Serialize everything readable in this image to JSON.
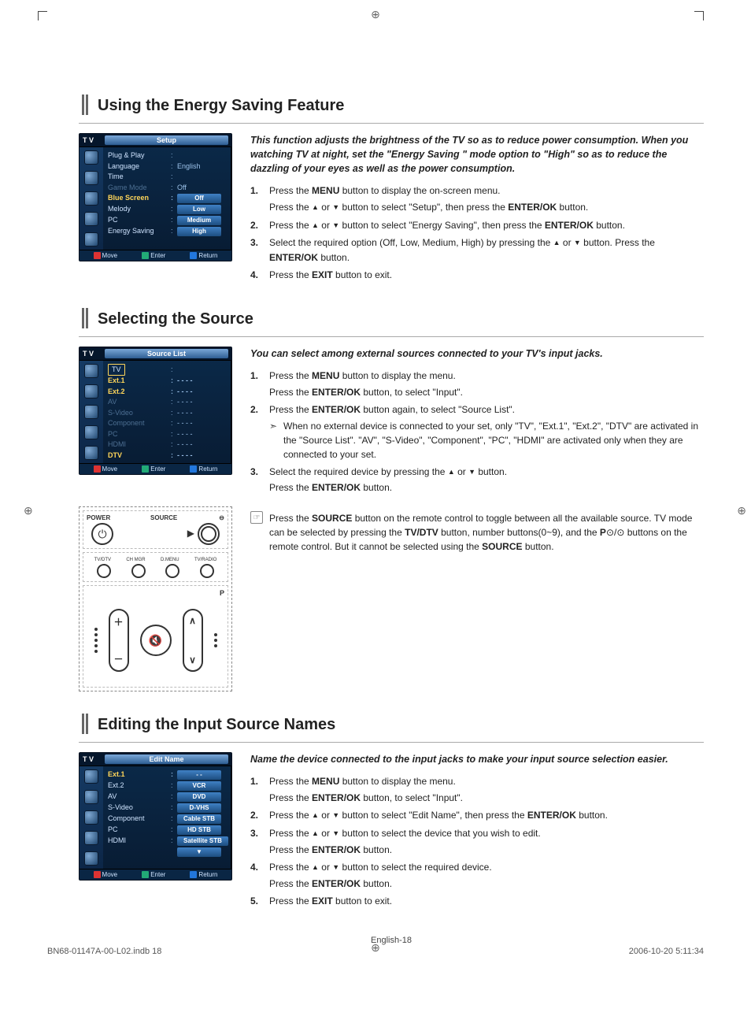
{
  "page": {
    "footer_left": "BN68-01147A-00-L02.indb   18",
    "footer_right": "2006-10-20   5:11:34",
    "page_number": "English-18"
  },
  "section1": {
    "title": "Using the Energy Saving Feature",
    "lead": "This function adjusts the brightness of the TV so as to reduce power consumption. When you watching TV at night, set the  \"Energy Saving \" mode option to \"High\" so as to reduce the dazzling of your eyes as well as the power consumption.",
    "steps": [
      {
        "n": "1.",
        "lines": [
          "Press the <b>MENU</b> button to display the on-screen menu.",
          "Press the <span class='tri'>▲</span> or <span class='tri'>▼</span> button to select \"Setup\", then press the <b>ENTER/OK</b> button."
        ]
      },
      {
        "n": "2.",
        "lines": [
          "Press the <span class='tri'>▲</span> or <span class='tri'>▼</span> button to select \"Energy Saving\", then press the <b>ENTER/OK</b> button."
        ]
      },
      {
        "n": "3.",
        "lines": [
          "Select the required option (Off, Low, Medium, High) by pressing the <span class='tri'>▲</span> or <span class='tri'>▼</span> button. Press the <b>ENTER/OK</b> button."
        ]
      },
      {
        "n": "4.",
        "lines": [
          "Press the <b>EXIT</b> button to exit."
        ]
      }
    ],
    "osd": {
      "header_tv": "T V",
      "header_title": "Setup",
      "rows": [
        {
          "label": "Plug & Play",
          "val": ""
        },
        {
          "label": "Language",
          "val": "English"
        },
        {
          "label": "Time",
          "val": ""
        },
        {
          "label": "Game Mode",
          "val": "Off",
          "dim": true
        },
        {
          "label": "Blue Screen",
          "val": "",
          "pill": "Off",
          "hl": true
        },
        {
          "label": "Melody",
          "val": "",
          "pill": "Low"
        },
        {
          "label": "PC",
          "val": "",
          "pill": "Medium"
        },
        {
          "label": "Energy Saving",
          "val": "",
          "pill": "High"
        }
      ],
      "foot": [
        "Move",
        "Enter",
        "Return"
      ]
    }
  },
  "section2": {
    "title": "Selecting the Source",
    "lead": "You can select among external sources connected to your TV's input jacks.",
    "steps": [
      {
        "n": "1.",
        "lines": [
          "Press the <b>MENU</b> button to display the menu.",
          "Press the <b>ENTER/OK</b> button, to select \"Input\"."
        ]
      },
      {
        "n": "2.",
        "lines": [
          "Press the <b>ENTER/OK</b> button again, to select \"Source List\".",
          "<div class='arrow-note'>When no external device is connected to your set, only \"TV\", \"Ext.1\", \"Ext.2\", \"DTV\"  are activated in the \"Source List\". \"AV\", \"S-Video\", \"Component\", \"PC\", \"HDMI\" are activated only when they are connected to your set.</div>"
        ]
      },
      {
        "n": "3.",
        "lines": [
          "Select the required device by pressing the <span class='tri'>▲</span> or <span class='tri'>▼</span> button.",
          "Press the <b>ENTER/OK</b> button."
        ]
      }
    ],
    "note": "Press the <b>SOURCE</b> button on the remote control to toggle between all the available source. TV mode can be selected by pressing the <b>TV/DTV</b> button, number buttons(0~9), and the <b>P</b>⊙/⊙ buttons on the remote control. But it cannot be selected using the <b>SOURCE</b> button.",
    "osd": {
      "header_tv": "T V",
      "header_title": "Source List",
      "rows": [
        {
          "label": "TV",
          "val": "",
          "sel": true
        },
        {
          "label": "Ext.1",
          "val": "- - - -",
          "hl": true
        },
        {
          "label": "Ext.2",
          "val": "- - - -",
          "hl": true
        },
        {
          "label": "AV",
          "val": "- - - -",
          "dim": true
        },
        {
          "label": "S-Video",
          "val": "- - - -",
          "dim": true
        },
        {
          "label": "Component",
          "val": "- - - -",
          "dim": true
        },
        {
          "label": "PC",
          "val": "- - - -",
          "dim": true
        },
        {
          "label": "HDMI",
          "val": "- - - -",
          "dim": true
        },
        {
          "label": "DTV",
          "val": "- - - -",
          "hl": true
        }
      ],
      "foot": [
        "Move",
        "Enter",
        "Return"
      ]
    },
    "remote": {
      "power": "POWER",
      "source": "SOURCE",
      "row": [
        "TV/DTV",
        "CH MGR",
        "D.MENU",
        "TV/RADIO"
      ]
    }
  },
  "section3": {
    "title": "Editing the Input Source Names",
    "lead": "Name the device connected to the input jacks to make your input source selection easier.",
    "steps": [
      {
        "n": "1.",
        "lines": [
          "Press the <b>MENU</b> button to display the menu.",
          "Press the <b>ENTER/OK</b> button, to select \"Input\"."
        ]
      },
      {
        "n": "2.",
        "lines": [
          "Press the <span class='tri'>▲</span> or <span class='tri'>▼</span> button to select \"Edit Name\", then press the <b>ENTER/OK</b> button."
        ]
      },
      {
        "n": "3.",
        "lines": [
          "Press the <span class='tri'>▲</span> or <span class='tri'>▼</span> button to select the device that you wish to edit.",
          "Press the <b>ENTER/OK</b>  button."
        ]
      },
      {
        "n": "4.",
        "lines": [
          "Press the <span class='tri'>▲</span> or <span class='tri'>▼</span> button to select the required device.",
          "Press the <b>ENTER/OK</b> button."
        ]
      },
      {
        "n": "5.",
        "lines": [
          "Press the <b>EXIT</b> button to exit."
        ]
      }
    ],
    "osd": {
      "header_tv": "T V",
      "header_title": "Edit Name",
      "rows": [
        {
          "label": "Ext.1",
          "val": "",
          "pill": "- -",
          "hl": true
        },
        {
          "label": "Ext.2",
          "val": "",
          "pill": "VCR"
        },
        {
          "label": "AV",
          "val": "",
          "pill": "DVD"
        },
        {
          "label": "S-Video",
          "val": "",
          "pill": "D-VHS"
        },
        {
          "label": "Component",
          "val": "",
          "pill": "Cable STB"
        },
        {
          "label": "PC",
          "val": "",
          "pill": "HD STB"
        },
        {
          "label": "HDMI",
          "val": "",
          "pill": "Satellite STB"
        },
        {
          "label": "",
          "val": "",
          "pill": "▼"
        }
      ],
      "foot": [
        "Move",
        "Enter",
        "Return"
      ]
    }
  }
}
